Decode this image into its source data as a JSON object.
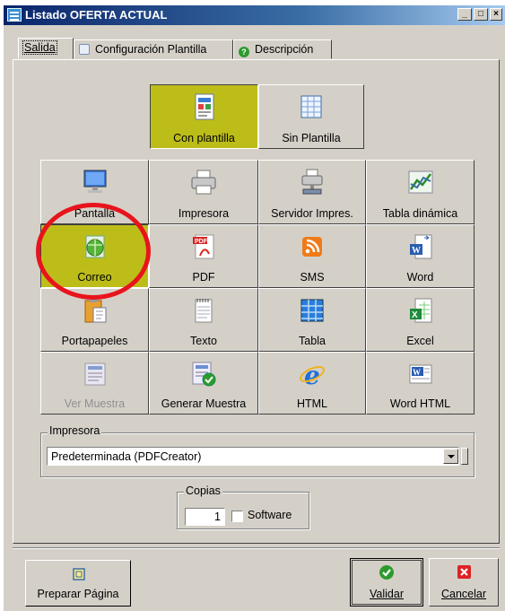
{
  "window": {
    "title": "Listado OFERTA ACTUAL",
    "controls": [
      "_",
      "□",
      "×"
    ]
  },
  "tabs": [
    {
      "label": "Salida",
      "icon": "none",
      "active": true
    },
    {
      "label": "Configuración Plantilla",
      "icon": "template-sheet-icon",
      "active": false
    },
    {
      "label": "Descripción",
      "icon": "green-question-icon",
      "active": false
    }
  ],
  "mode": {
    "con_plantilla": "Con plantilla",
    "sin_plantilla": "Sin Plantilla",
    "selected": "Con plantilla"
  },
  "outputs": [
    {
      "label": "Pantalla",
      "icon": "monitor-icon"
    },
    {
      "label": "Impresora",
      "icon": "printer-icon"
    },
    {
      "label": "Servidor Impres.",
      "icon": "print-server-icon"
    },
    {
      "label": "Tabla dinámica",
      "icon": "pivot-chart-icon"
    },
    {
      "label": "Correo",
      "icon": "email-globe-icon",
      "selected": true
    },
    {
      "label": "PDF",
      "icon": "pdf-icon"
    },
    {
      "label": "SMS",
      "icon": "rss-sms-icon"
    },
    {
      "label": "Word",
      "icon": "word-doc-icon"
    },
    {
      "label": "Portapapeles",
      "icon": "clipboard-icon"
    },
    {
      "label": "Texto",
      "icon": "notepad-icon"
    },
    {
      "label": "Tabla",
      "icon": "table-icon"
    },
    {
      "label": "Excel",
      "icon": "excel-doc-icon"
    },
    {
      "label": "Ver Muestra",
      "icon": "view-sample-icon",
      "disabled": true
    },
    {
      "label": "Generar  Muestra",
      "icon": "generate-sample-icon"
    },
    {
      "label": "HTML",
      "icon": "internet-explorer-icon"
    },
    {
      "label": "Word HTML",
      "icon": "word-html-icon"
    }
  ],
  "printer": {
    "group_label": "Impresora",
    "value": "Predeterminada (PDFCreator)"
  },
  "copies": {
    "group_label": "Copias",
    "value": "1",
    "software_label": "Software",
    "software_checked": false
  },
  "footer": {
    "preparar": "Preparar Página",
    "validar": "Validar",
    "cancelar": "Cancelar"
  },
  "colors": {
    "selected_bg": "#bdbd1a",
    "annotation_red": "#e8141c",
    "dialog_bg": "#d4d0c8"
  }
}
